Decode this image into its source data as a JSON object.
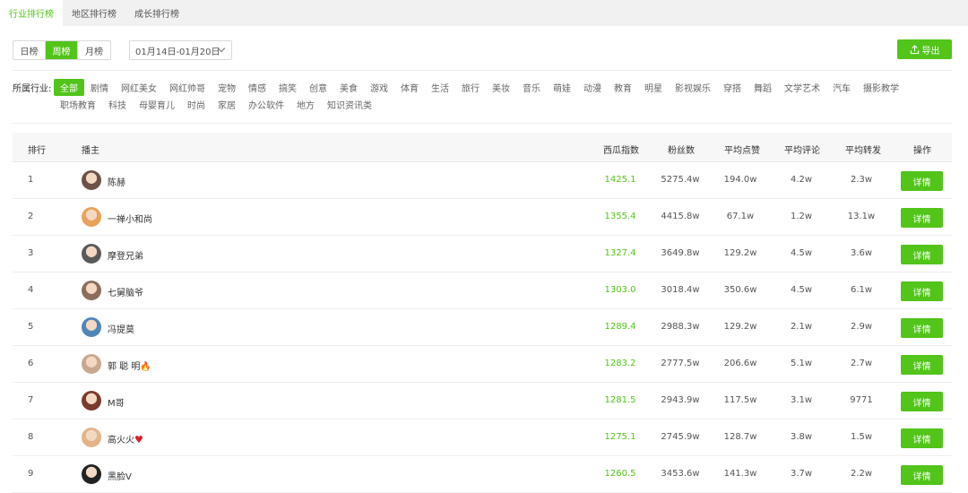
{
  "tabs": [
    {
      "label": "行业排行榜",
      "active": true
    },
    {
      "label": "地区排行榜",
      "active": false
    },
    {
      "label": "成长排行榜",
      "active": false
    }
  ],
  "period": {
    "options": [
      {
        "label": "日榜",
        "active": false
      },
      {
        "label": "周榜",
        "active": true
      },
      {
        "label": "月榜",
        "active": false
      }
    ],
    "date_range": "01月14日-01月20日"
  },
  "export_label": "导出",
  "industry": {
    "label": "所属行业:",
    "row1": [
      "全部",
      "剧情",
      "网红美女",
      "网红帅哥",
      "宠物",
      "情感",
      "搞笑",
      "创意",
      "美食",
      "游戏",
      "体育",
      "生活",
      "旅行",
      "美妆",
      "音乐",
      "萌娃",
      "动漫",
      "教育",
      "明星",
      "影视娱乐",
      "穿搭",
      "舞蹈",
      "文学艺术",
      "汽车",
      "摄影教学"
    ],
    "row2": [
      "职场教育",
      "科技",
      "母婴育儿",
      "时尚",
      "家居",
      "办公软件",
      "地方",
      "知识资讯类"
    ],
    "active": "全部"
  },
  "columns": {
    "rank": "排行",
    "host": "播主",
    "xigua": "西瓜指数",
    "fans": "粉丝数",
    "likes": "平均点赞",
    "comments": "平均评论",
    "shares": "平均转发",
    "action": "操作"
  },
  "detail_label": "详情",
  "colors": {
    "accent": "#52c41a"
  },
  "rows": [
    {
      "rank": "1",
      "name": "陈赫",
      "xigua": "1425.1",
      "fans": "5275.4w",
      "likes": "194.0w",
      "comments": "4.2w",
      "shares": "2.3w",
      "avatar": "#6b5148",
      "badge": ""
    },
    {
      "rank": "2",
      "name": "一禅小和尚",
      "xigua": "1355.4",
      "fans": "4415.8w",
      "likes": "67.1w",
      "comments": "1.2w",
      "shares": "13.1w",
      "avatar": "#e8a35a",
      "badge": ""
    },
    {
      "rank": "3",
      "name": "摩登兄弟",
      "xigua": "1327.4",
      "fans": "3649.8w",
      "likes": "129.2w",
      "comments": "4.5w",
      "shares": "3.6w",
      "avatar": "#5a5a5a",
      "badge": ""
    },
    {
      "rank": "4",
      "name": "七舅脑爷",
      "xigua": "1303.0",
      "fans": "3018.4w",
      "likes": "350.6w",
      "comments": "4.5w",
      "shares": "6.1w",
      "avatar": "#8a6d5a",
      "badge": ""
    },
    {
      "rank": "5",
      "name": "冯提莫",
      "xigua": "1289.4",
      "fans": "2988.3w",
      "likes": "129.2w",
      "comments": "2.1w",
      "shares": "2.9w",
      "avatar": "#4f86b8",
      "badge": ""
    },
    {
      "rank": "6",
      "name": "郭 聪 明",
      "xigua": "1283.2",
      "fans": "2777.5w",
      "likes": "206.6w",
      "comments": "5.1w",
      "shares": "2.7w",
      "avatar": "#c9a88f",
      "badge": "fire"
    },
    {
      "rank": "7",
      "name": "M哥",
      "xigua": "1281.5",
      "fans": "2943.9w",
      "likes": "117.5w",
      "comments": "3.1w",
      "shares": "9771",
      "avatar": "#7a3a2e",
      "badge": ""
    },
    {
      "rank": "8",
      "name": "高火火",
      "xigua": "1275.1",
      "fans": "2745.9w",
      "likes": "128.7w",
      "comments": "3.8w",
      "shares": "1.5w",
      "avatar": "#e3b48a",
      "badge": "heart"
    },
    {
      "rank": "9",
      "name": "黑脸V",
      "xigua": "1260.5",
      "fans": "3453.6w",
      "likes": "141.3w",
      "comments": "3.7w",
      "shares": "2.2w",
      "avatar": "#222222",
      "badge": ""
    }
  ]
}
